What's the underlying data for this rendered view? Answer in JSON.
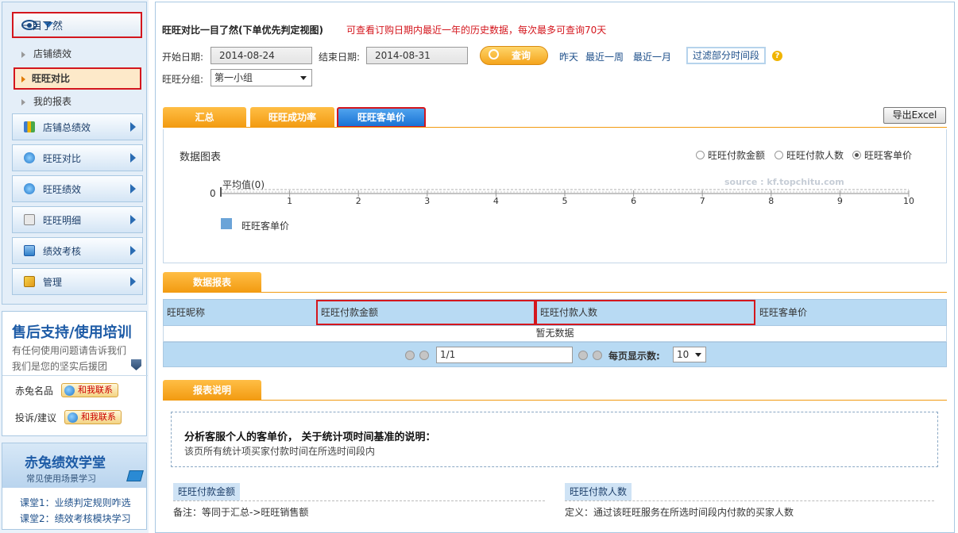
{
  "sidebar": {
    "nav_head": "一目了然",
    "sub_items": [
      "店铺绩效",
      "旺旺对比",
      "我的报表"
    ],
    "menu": [
      "店铺总绩效",
      "旺旺对比",
      "旺旺绩效",
      "旺旺明细",
      "绩效考核",
      "管理"
    ],
    "support": {
      "title": "售后支持/使用培训",
      "line1": "有任何使用问题请告诉我们",
      "line2": "我们是您的坚实后援团",
      "row1_label": "赤兔名品",
      "row2_label": "投诉/建议",
      "contact_label": "和我联系"
    },
    "school": {
      "title": "赤兔绩效学堂",
      "subtitle": "常见使用场景学习",
      "lesson1": "课堂1：业绩判定规则咋选",
      "lesson2": "课堂2：绩效考核模块学习"
    }
  },
  "header": {
    "title": "旺旺对比一目了然(下单优先判定视图)",
    "note": "可查看订购日期内最近一年的历史数据，每次最多可查询70天"
  },
  "filters": {
    "start_label": "开始日期:",
    "start_value": "2014-08-24",
    "end_label": "结束日期:",
    "end_value": "2014-08-31",
    "query_label": "查询",
    "quick": [
      "昨天",
      "最近一周",
      "最近一月"
    ],
    "filter_time": "过滤部分时间段",
    "help": "?",
    "group_label": "旺旺分组:",
    "group_value": "第一小组"
  },
  "tabs": [
    "汇总",
    "旺旺成功率",
    "旺旺客单价"
  ],
  "export_label": "导出Excel",
  "chart_section": {
    "caption": "数据图表",
    "radio_options": [
      "旺旺付款金额",
      "旺旺付款人数",
      "旺旺客单价"
    ],
    "selected_radio": "旺旺客单价",
    "watermark": "source : kf.topchitu.com",
    "avg_label": "平均值(0)",
    "legend": "旺旺客单价"
  },
  "chart_data": {
    "type": "bar",
    "orientation": "horizontal",
    "categories": [],
    "series": [
      {
        "name": "旺旺客单价",
        "values": []
      }
    ],
    "average": 0,
    "y_tick_labels": [
      "0"
    ],
    "x_ticks": [
      1,
      2,
      3,
      4,
      5,
      6,
      7,
      8,
      9,
      10
    ],
    "xlim": [
      0,
      10
    ],
    "color": "#6ba4d8",
    "legend_position": "bottom-left"
  },
  "report": {
    "tab": "数据报表",
    "columns": [
      "旺旺昵称",
      "旺旺付款金额",
      "旺旺付款人数",
      "旺旺客单价"
    ],
    "empty_text": "暂无数据",
    "page_value": "1/1",
    "per_page_label": "每页显示数:",
    "per_page_value": "10"
  },
  "description": {
    "tab": "报表说明",
    "title": "分析客服个人的客单价， 关于统计项时间基准的说明：",
    "text": "该页所有统计项买家付款时间在所选时间段内",
    "def1_head": "旺旺付款金额",
    "def1_text": "备注：等同于汇总->旺旺销售额",
    "def2_head": "旺旺付款人数",
    "def2_text": "定义：通过该旺旺服务在所选时间段内付款的买家人数"
  },
  "colors": {
    "accent_orange": "#f29a10",
    "accent_blue": "#1a73d4",
    "highlight_red": "#d4161d",
    "table_header": "#b8daf3"
  }
}
